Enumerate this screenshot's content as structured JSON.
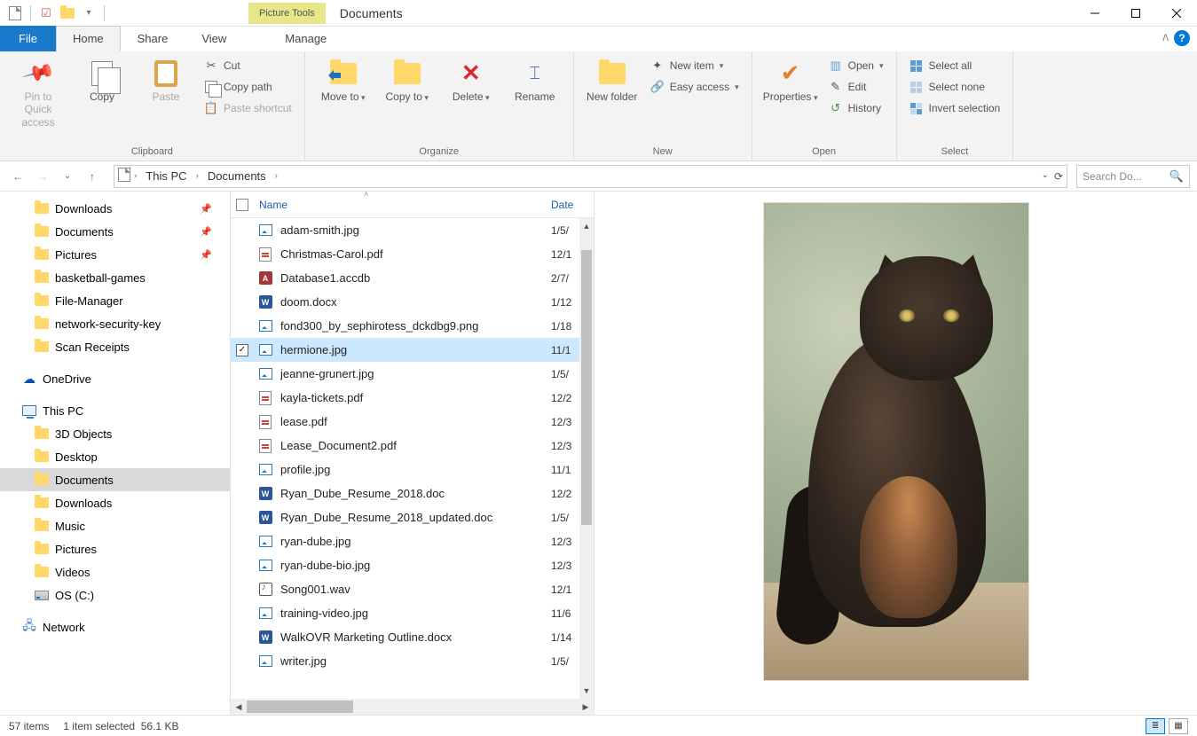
{
  "window": {
    "title": "Documents",
    "picture_tools": "Picture Tools"
  },
  "tabs": {
    "file": "File",
    "home": "Home",
    "share": "Share",
    "view": "View",
    "manage": "Manage"
  },
  "ribbon": {
    "clipboard": {
      "label": "Clipboard",
      "pin": "Pin to Quick access",
      "copy": "Copy",
      "paste": "Paste",
      "cut": "Cut",
      "copy_path": "Copy path",
      "paste_shortcut": "Paste shortcut"
    },
    "organize": {
      "label": "Organize",
      "move_to": "Move to",
      "copy_to": "Copy to",
      "delete": "Delete",
      "rename": "Rename"
    },
    "new": {
      "label": "New",
      "new_folder": "New folder",
      "new_item": "New item",
      "easy_access": "Easy access"
    },
    "open": {
      "label": "Open",
      "properties": "Properties",
      "open": "Open",
      "edit": "Edit",
      "history": "History"
    },
    "select": {
      "label": "Select",
      "select_all": "Select all",
      "select_none": "Select none",
      "invert": "Invert selection"
    }
  },
  "breadcrumbs": {
    "pc": "This PC",
    "folder": "Documents"
  },
  "search": {
    "placeholder": "Search Do..."
  },
  "navpane": {
    "quick": [
      {
        "label": "Downloads",
        "pinned": true
      },
      {
        "label": "Documents",
        "pinned": true
      },
      {
        "label": "Pictures",
        "pinned": true
      },
      {
        "label": "basketball-games",
        "pinned": false
      },
      {
        "label": "File-Manager",
        "pinned": false
      },
      {
        "label": "network-security-key",
        "pinned": false
      },
      {
        "label": "Scan Receipts",
        "pinned": false
      }
    ],
    "onedrive": "OneDrive",
    "thispc": "This PC",
    "pc_items": [
      {
        "label": "3D Objects",
        "icon": "folder"
      },
      {
        "label": "Desktop",
        "icon": "folder"
      },
      {
        "label": "Documents",
        "icon": "folder",
        "selected": true
      },
      {
        "label": "Downloads",
        "icon": "folder"
      },
      {
        "label": "Music",
        "icon": "folder"
      },
      {
        "label": "Pictures",
        "icon": "folder"
      },
      {
        "label": "Videos",
        "icon": "folder"
      },
      {
        "label": "OS (C:)",
        "icon": "drive"
      }
    ],
    "network": "Network"
  },
  "columns": {
    "name": "Name",
    "date": "Date"
  },
  "files": [
    {
      "name": "adam-smith.jpg",
      "date": "1/5/",
      "ico": "img"
    },
    {
      "name": "Christmas-Carol.pdf",
      "date": "12/1",
      "ico": "pdf"
    },
    {
      "name": "Database1.accdb",
      "date": "2/7/",
      "ico": "access"
    },
    {
      "name": "doom.docx",
      "date": "1/12",
      "ico": "word"
    },
    {
      "name": "fond300_by_sephirotess_dckdbg9.png",
      "date": "1/18",
      "ico": "img"
    },
    {
      "name": "hermione.jpg",
      "date": "11/1",
      "ico": "img",
      "selected": true
    },
    {
      "name": "jeanne-grunert.jpg",
      "date": "1/5/",
      "ico": "img"
    },
    {
      "name": "kayla-tickets.pdf",
      "date": "12/2",
      "ico": "pdf"
    },
    {
      "name": "lease.pdf",
      "date": "12/3",
      "ico": "pdf"
    },
    {
      "name": "Lease_Document2.pdf",
      "date": "12/3",
      "ico": "pdf"
    },
    {
      "name": "profile.jpg",
      "date": "11/1",
      "ico": "img"
    },
    {
      "name": "Ryan_Dube_Resume_2018.doc",
      "date": "12/2",
      "ico": "word"
    },
    {
      "name": "Ryan_Dube_Resume_2018_updated.doc",
      "date": "1/5/",
      "ico": "word"
    },
    {
      "name": "ryan-dube.jpg",
      "date": "12/3",
      "ico": "img"
    },
    {
      "name": "ryan-dube-bio.jpg",
      "date": "12/3",
      "ico": "img"
    },
    {
      "name": "Song001.wav",
      "date": "12/1",
      "ico": "wav"
    },
    {
      "name": "training-video.jpg",
      "date": "11/6",
      "ico": "img"
    },
    {
      "name": "WalkOVR Marketing Outline.docx",
      "date": "1/14",
      "ico": "word"
    },
    {
      "name": "writer.jpg",
      "date": "1/5/",
      "ico": "img"
    }
  ],
  "status": {
    "items": "57 items",
    "selected": "1 item selected",
    "size": "56.1 KB"
  }
}
